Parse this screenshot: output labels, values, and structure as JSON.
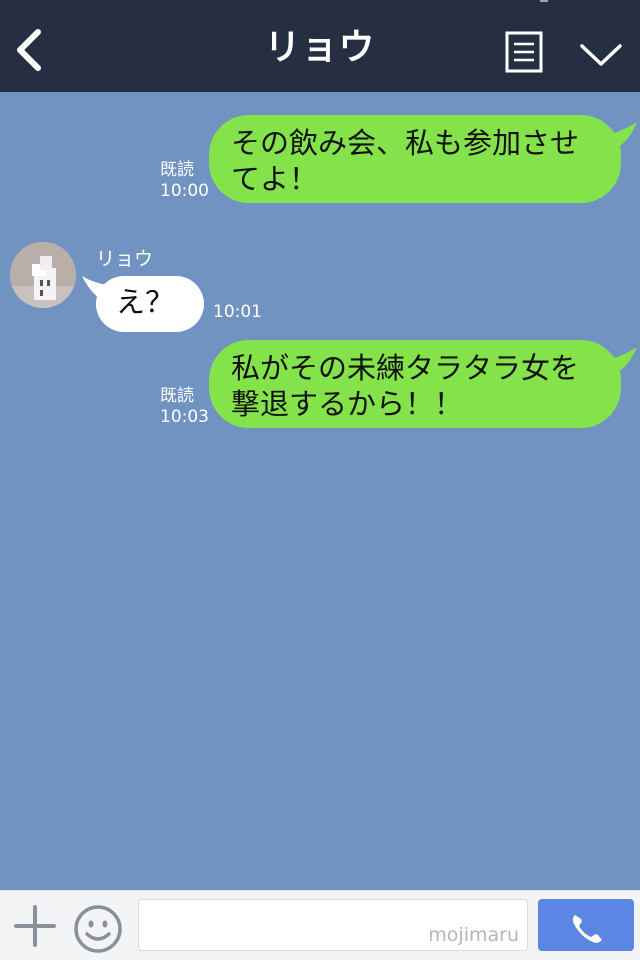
{
  "header": {
    "title": "リョウ",
    "icons": {
      "back": "back-chevron-icon",
      "menu": "menu-list-icon",
      "collapse": "chevron-down-icon"
    },
    "color": "#262e42"
  },
  "messages": [
    {
      "from": "me",
      "text": "その飲み会、私も参加させてよ！",
      "status": "既読",
      "time": "10:00"
    },
    {
      "from": "other",
      "sender": "リョウ",
      "text": "え？",
      "time": "10:01"
    },
    {
      "from": "me",
      "text": "私がその未練タラタラ女を撃退するから！！",
      "status": "既読",
      "time": "10:03"
    }
  ],
  "footer": {
    "input_value": "",
    "watermark": "mojimaru",
    "icons": {
      "add": "plus-icon",
      "emoji": "smile-icon",
      "call": "phone-icon"
    }
  },
  "colors": {
    "background": "#7093c1",
    "my_bubble": "#84e34b",
    "other_bubble": "#ffffff",
    "call_button": "#5b86e3"
  }
}
